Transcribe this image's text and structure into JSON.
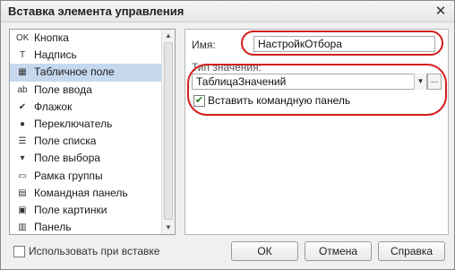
{
  "window": {
    "title": "Вставка элемента управления",
    "close_glyph": "✕"
  },
  "list": {
    "items": [
      {
        "label": "Кнопка",
        "icon": "button-icon",
        "glyph": "OK",
        "selected": false
      },
      {
        "label": "Надпись",
        "icon": "label-icon",
        "glyph": "T",
        "selected": false
      },
      {
        "label": "Табличное поле",
        "icon": "table-icon",
        "glyph": "▦",
        "selected": true
      },
      {
        "label": "Поле ввода",
        "icon": "input-field-icon",
        "glyph": "ab",
        "selected": false
      },
      {
        "label": "Флажок",
        "icon": "checkbox-icon",
        "glyph": "✔",
        "selected": false
      },
      {
        "label": "Переключатель",
        "icon": "radio-icon",
        "glyph": "●",
        "selected": false
      },
      {
        "label": "Поле списка",
        "icon": "list-field-icon",
        "glyph": "☰",
        "selected": false
      },
      {
        "label": "Поле выбора",
        "icon": "select-field-icon",
        "glyph": "▾",
        "selected": false
      },
      {
        "label": "Рамка группы",
        "icon": "group-frame-icon",
        "glyph": "▭",
        "selected": false
      },
      {
        "label": "Командная панель",
        "icon": "command-panel-icon",
        "glyph": "▤",
        "selected": false
      },
      {
        "label": "Поле картинки",
        "icon": "picture-field-icon",
        "glyph": "▣",
        "selected": false
      },
      {
        "label": "Панель",
        "icon": "panel-icon",
        "glyph": "▥",
        "selected": false
      }
    ],
    "scroll_up_glyph": "▲",
    "scroll_down_glyph": "▼"
  },
  "form": {
    "name_label": "Имя:",
    "name_value": "НастройкОтбора",
    "type_label": "Тип значения:",
    "type_value": "ТаблицаЗначений",
    "type_dropdown_glyph": "▼",
    "type_select_glyph": "...",
    "insert_panel_checked": true,
    "insert_panel_label": "Вставить командную панель",
    "check_glyph": "✔"
  },
  "footer": {
    "use_on_insert_label": "Использовать при вставке",
    "use_on_insert_checked": false,
    "ok_label": "ОК",
    "cancel_label": "Отмена",
    "help_label": "Справка"
  },
  "colors": {
    "highlight_oval": "#d41c1c",
    "selection": "#c6d8ee"
  }
}
